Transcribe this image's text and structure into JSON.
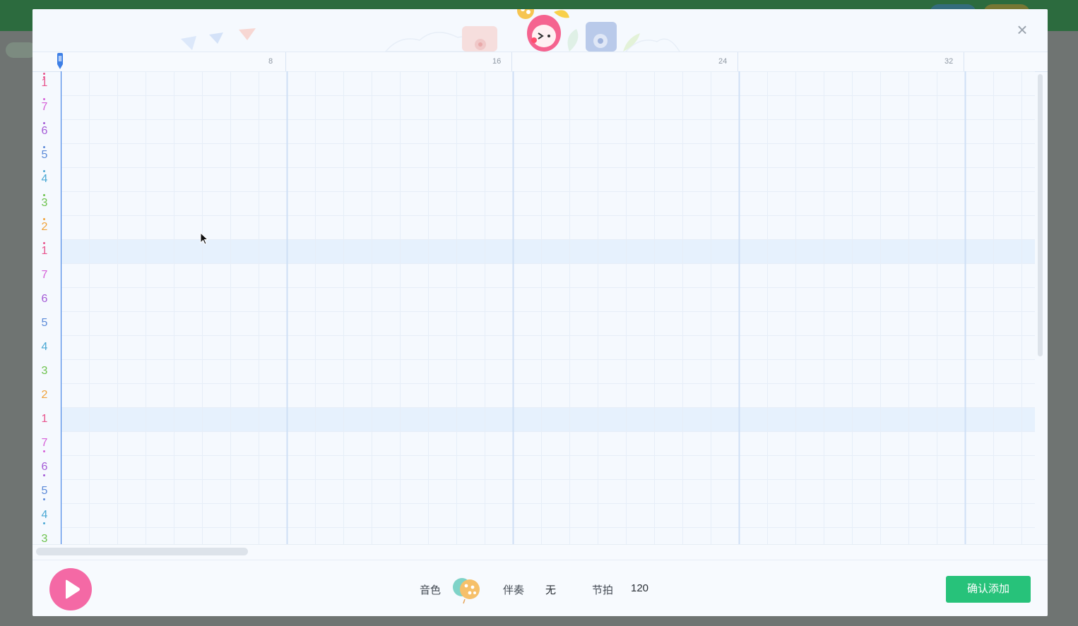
{
  "dialog": {
    "close_symbol": "×"
  },
  "ruler": {
    "labels": [
      "8",
      "16",
      "24",
      "32"
    ]
  },
  "notes": [
    {
      "digit": "1",
      "octave": "high",
      "color": "#e8548e"
    },
    {
      "digit": "7",
      "octave": "mid",
      "color": "#d660d8"
    },
    {
      "digit": "6",
      "octave": "mid",
      "color": "#a45bd6"
    },
    {
      "digit": "5",
      "octave": "mid",
      "color": "#5b8ad8"
    },
    {
      "digit": "4",
      "octave": "mid",
      "color": "#4aa8d4"
    },
    {
      "digit": "3",
      "octave": "mid",
      "color": "#6cc24c"
    },
    {
      "digit": "2",
      "octave": "mid",
      "color": "#f0a23a"
    },
    {
      "digit": "1",
      "octave": "mid",
      "color": "#e8548e"
    },
    {
      "digit": "7",
      "octave": "base",
      "color": "#d660d8"
    },
    {
      "digit": "6",
      "octave": "base",
      "color": "#a45bd6"
    },
    {
      "digit": "5",
      "octave": "base",
      "color": "#5b8ad8"
    },
    {
      "digit": "4",
      "octave": "base",
      "color": "#4aa8d4"
    },
    {
      "digit": "3",
      "octave": "base",
      "color": "#6cc24c"
    },
    {
      "digit": "2",
      "octave": "base",
      "color": "#f0a23a"
    },
    {
      "digit": "1",
      "octave": "base",
      "color": "#e8548e"
    },
    {
      "digit": "7",
      "octave": "low",
      "color": "#d660d8"
    },
    {
      "digit": "6",
      "octave": "low",
      "color": "#a45bd6"
    },
    {
      "digit": "5",
      "octave": "low",
      "color": "#5b8ad8"
    },
    {
      "digit": "4",
      "octave": "low",
      "color": "#4aa8d4"
    },
    {
      "digit": "3",
      "octave": "low",
      "color": "#6cc24c"
    }
  ],
  "footer": {
    "timbre_label": "音色",
    "timbre_icon": "balloon-icon",
    "accompaniment_label": "伴奏",
    "accompaniment_value": "无",
    "tempo_label": "节拍",
    "tempo_value": "120",
    "confirm_label": "确认添加"
  },
  "colors": {
    "accent_green": "#27c27a",
    "play_pink": "#f469a5",
    "grid_line": "#e6eef8",
    "bar_line": "#cfe0f5",
    "highlight_row": "#e6f1fd"
  }
}
